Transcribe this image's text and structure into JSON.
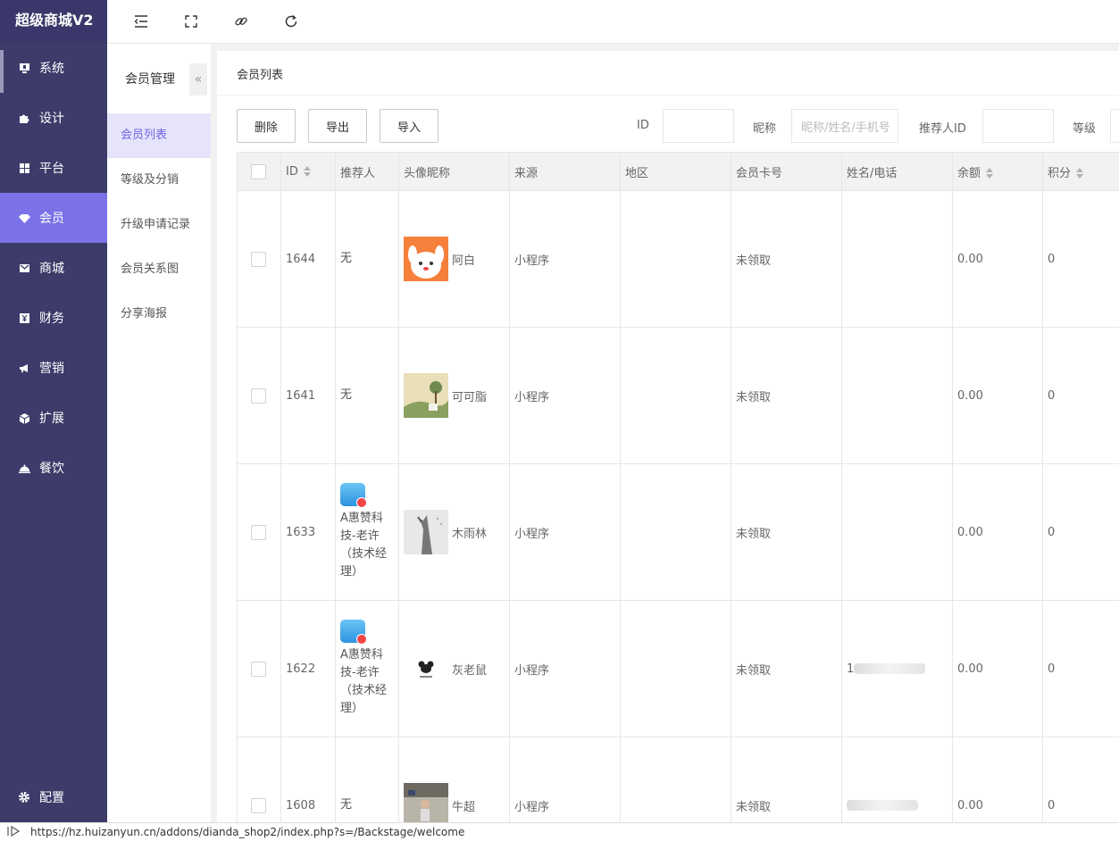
{
  "brand": "超级商城V2",
  "nav": [
    {
      "label": "系统",
      "icon": "monitor-icon"
    },
    {
      "label": "设计",
      "icon": "puzzle-icon"
    },
    {
      "label": "平台",
      "icon": "grid-icon"
    },
    {
      "label": "会员",
      "icon": "diamond-icon"
    },
    {
      "label": "商城",
      "icon": "mail-icon"
    },
    {
      "label": "财务",
      "icon": "yen-icon"
    },
    {
      "label": "营销",
      "icon": "megaphone-icon"
    },
    {
      "label": "扩展",
      "icon": "cube-icon"
    },
    {
      "label": "餐饮",
      "icon": "cloche-icon"
    }
  ],
  "nav_bottom": {
    "label": "配置",
    "icon": "gear-icon"
  },
  "submenu": {
    "title": "会员管理",
    "collapse": "«",
    "items": [
      "会员列表",
      "等级及分销",
      "升级申请记录",
      "会员关系图",
      "分享海报"
    ]
  },
  "content": {
    "title": "会员列表",
    "buttons": {
      "delete": "删除",
      "export": "导出",
      "import": "导入"
    },
    "filters": {
      "id_label": "ID",
      "nickname_label": "昵称",
      "nickname_placeholder": "昵称/姓名/手机号",
      "referrer_label": "推荐人ID",
      "level_label": "等级"
    }
  },
  "table": {
    "columns": [
      "ID",
      "推荐人",
      "头像昵称",
      "来源",
      "地区",
      "会员卡号",
      "姓名/电话",
      "余额",
      "积分"
    ],
    "rows": [
      {
        "id": "1644",
        "referrer_lines": [
          "无"
        ],
        "referrer_badge": false,
        "nickname": "阿白",
        "source": "小程序",
        "region": "",
        "card": "未领取",
        "phone": "",
        "balance": "0.00",
        "points": "0"
      },
      {
        "id": "1641",
        "referrer_lines": [
          "无"
        ],
        "referrer_badge": false,
        "nickname": "可可脂",
        "source": "小程序",
        "region": "",
        "card": "未领取",
        "phone": "",
        "balance": "0.00",
        "points": "0"
      },
      {
        "id": "1633",
        "referrer_lines": [
          "A惠赞科",
          "技-老许",
          "（技术经",
          "理）"
        ],
        "referrer_badge": true,
        "nickname": "木雨林",
        "source": "小程序",
        "region": "",
        "card": "未领取",
        "phone": "",
        "balance": "0.00",
        "points": "0"
      },
      {
        "id": "1622",
        "referrer_lines": [
          "A惠赞科",
          "技-老许",
          "（技术经",
          "理）"
        ],
        "referrer_badge": true,
        "nickname": "灰老鼠",
        "source": "小程序",
        "region": "",
        "card": "未领取",
        "phone": "1",
        "balance": "0.00",
        "points": "0"
      },
      {
        "id": "1608",
        "referrer_lines": [
          "无"
        ],
        "referrer_badge": false,
        "nickname": "牛超",
        "source": "小程序",
        "region": "",
        "card": "未领取",
        "phone": "",
        "balance": "0.00",
        "points": "0"
      }
    ]
  },
  "statusbar": {
    "url": "https://hz.huizanyun.cn/addons/dianda_shop2/index.php?s=/Backstage/welcome"
  }
}
